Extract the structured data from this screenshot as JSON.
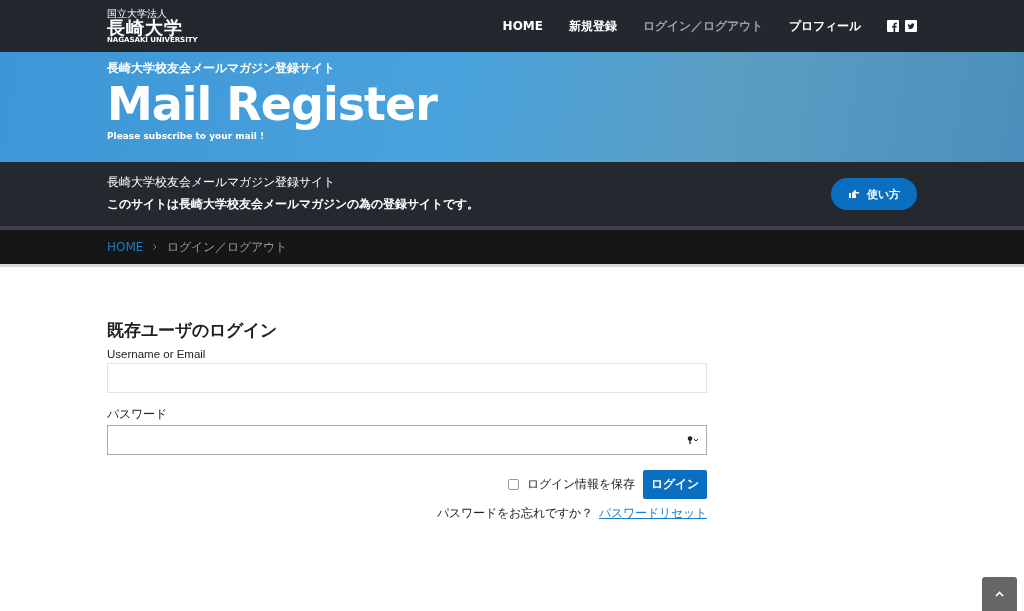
{
  "header": {
    "logo": {
      "caption": "国立大学法人",
      "name": "長崎大学",
      "english": "NAGASAKI UNIVERSITY"
    },
    "nav": [
      {
        "label": "HOME",
        "selected": false
      },
      {
        "label": "新規登録",
        "selected": false
      },
      {
        "label": "ログイン／ログアウト",
        "selected": true
      },
      {
        "label": "プロフィール",
        "selected": false
      }
    ]
  },
  "hero": {
    "subtitle": "長崎大学校友会メールマガジン登録サイト",
    "title": "Mail Register",
    "tagline": "Please subscribe to your mail !"
  },
  "info": {
    "title": "長崎大学校友会メールマガジン登録サイト",
    "description": "このサイトは長崎大学校友会メールマガジンの為の登録サイトです。",
    "button": "使い方"
  },
  "breadcrumb": [
    {
      "label": "HOME",
      "kind": "link"
    },
    {
      "label": "ログイン／ログアウト",
      "kind": "current"
    }
  ],
  "login": {
    "heading": "既存ユーザのログイン",
    "username_label": "Username or Email",
    "password_label": "パスワード",
    "remember": {
      "label": "ログイン情報を保存",
      "checked": false
    },
    "submit": "ログイン",
    "forgot_text": "パスワードをお忘れですか？",
    "reset_link": "パスワードリセット"
  }
}
